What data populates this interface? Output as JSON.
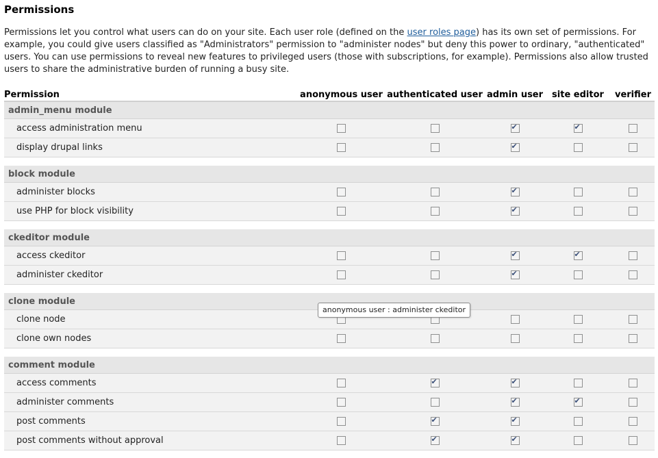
{
  "page": {
    "title": "Permissions",
    "intro_before_link": "Permissions let you control what users can do on your site. Each user role (defined on the ",
    "intro_link": "user roles page",
    "intro_after_link": ") has its own set of permissions. For example, you could give users classified as \"Administrators\" permission to \"administer nodes\" but deny this power to ordinary, \"authenticated\" users. You can use permissions to reveal new features to privileged users (those with subscriptions, for example). Permissions also allow trusted users to share the administrative burden of running a busy site."
  },
  "table": {
    "columns": [
      "Permission",
      "anonymous user",
      "authenticated user",
      "admin user",
      "site editor",
      "verifier"
    ],
    "modules": [
      {
        "name": "admin_menu module",
        "permissions": [
          {
            "label": "access administration menu",
            "checks": [
              false,
              false,
              true,
              true,
              false
            ]
          },
          {
            "label": "display drupal links",
            "checks": [
              false,
              false,
              true,
              false,
              false
            ]
          }
        ]
      },
      {
        "name": "block module",
        "permissions": [
          {
            "label": "administer blocks",
            "checks": [
              false,
              false,
              true,
              false,
              false
            ]
          },
          {
            "label": "use PHP for block visibility",
            "checks": [
              false,
              false,
              true,
              false,
              false
            ]
          }
        ]
      },
      {
        "name": "ckeditor module",
        "permissions": [
          {
            "label": "access ckeditor",
            "checks": [
              false,
              false,
              true,
              true,
              false
            ]
          },
          {
            "label": "administer ckeditor",
            "checks": [
              false,
              false,
              true,
              false,
              false
            ]
          }
        ]
      },
      {
        "name": "clone module",
        "permissions": [
          {
            "label": "clone node",
            "checks": [
              false,
              false,
              false,
              false,
              false
            ]
          },
          {
            "label": "clone own nodes",
            "checks": [
              false,
              false,
              false,
              false,
              false
            ]
          }
        ]
      },
      {
        "name": "comment module",
        "permissions": [
          {
            "label": "access comments",
            "checks": [
              false,
              true,
              true,
              false,
              false
            ]
          },
          {
            "label": "administer comments",
            "checks": [
              false,
              false,
              true,
              true,
              false
            ]
          },
          {
            "label": "post comments",
            "checks": [
              false,
              true,
              true,
              false,
              false
            ]
          },
          {
            "label": "post comments without approval",
            "checks": [
              false,
              true,
              true,
              false,
              false
            ]
          }
        ]
      }
    ]
  },
  "tooltip": {
    "text": "anonymous user : administer ckeditor"
  }
}
